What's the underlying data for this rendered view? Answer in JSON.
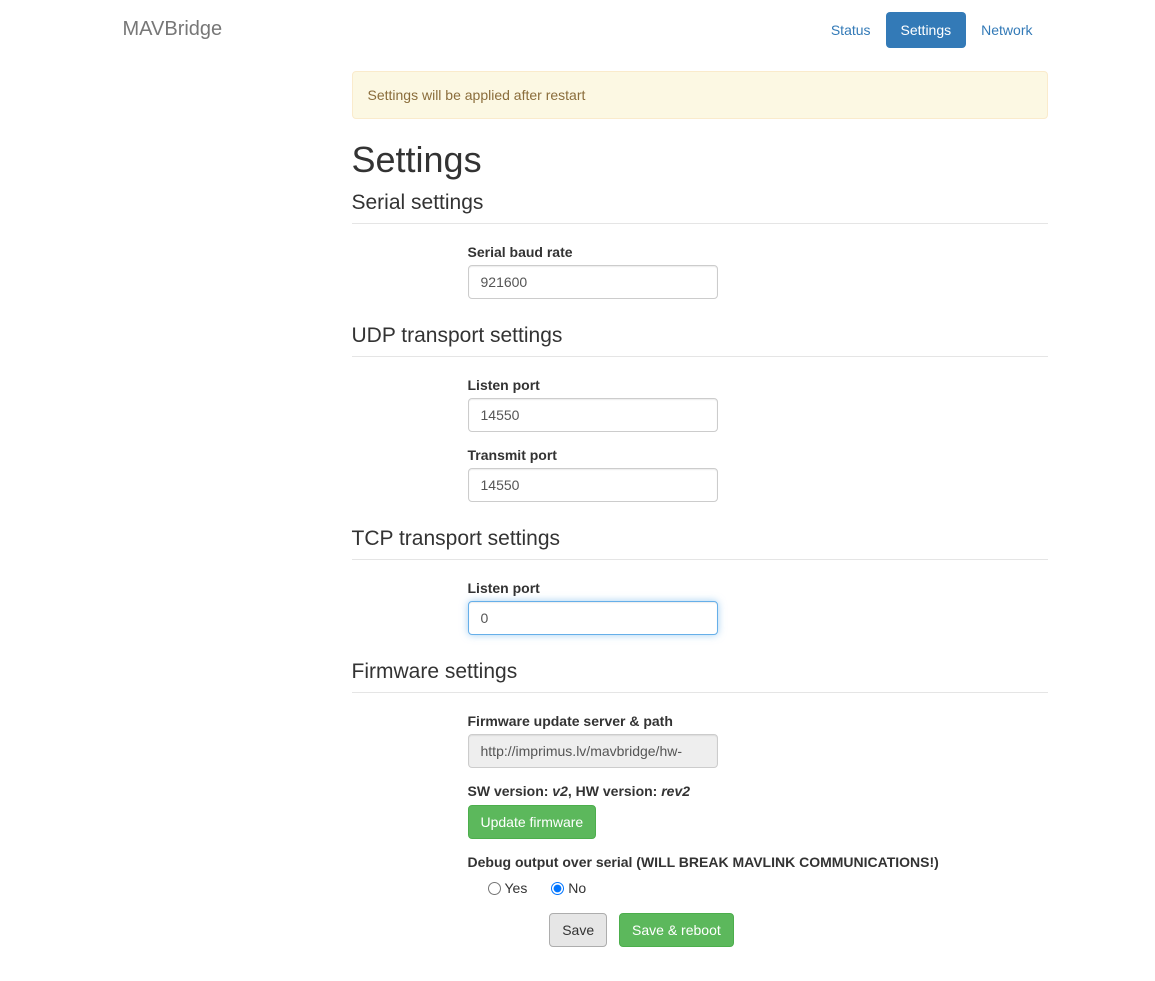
{
  "brand": "MAVBridge",
  "nav": {
    "status": "Status",
    "settings": "Settings",
    "network": "Network"
  },
  "alert": "Settings will be applied after restart",
  "page_title": "Settings",
  "sections": {
    "serial": {
      "legend": "Serial settings",
      "baud_label": "Serial baud rate",
      "baud_value": "921600"
    },
    "udp": {
      "legend": "UDP transport settings",
      "listen_label": "Listen port",
      "listen_value": "14550",
      "transmit_label": "Transmit port",
      "transmit_value": "14550"
    },
    "tcp": {
      "legend": "TCP transport settings",
      "listen_label": "Listen port",
      "listen_value": "0"
    },
    "firmware": {
      "legend": "Firmware settings",
      "server_label": "Firmware update server & path",
      "server_value": "http://imprimus.lv/mavbridge/hw-",
      "sw_label": "SW version: ",
      "sw_value": "v2",
      "hw_label": ", HW version: ",
      "hw_value": "rev2",
      "update_btn": "Update firmware",
      "debug_label": "Debug output over serial (WILL BREAK MAVLINK COMMUNICATIONS!)",
      "yes": "Yes",
      "no": "No"
    }
  },
  "buttons": {
    "save": "Save",
    "save_reboot": "Save & reboot"
  }
}
